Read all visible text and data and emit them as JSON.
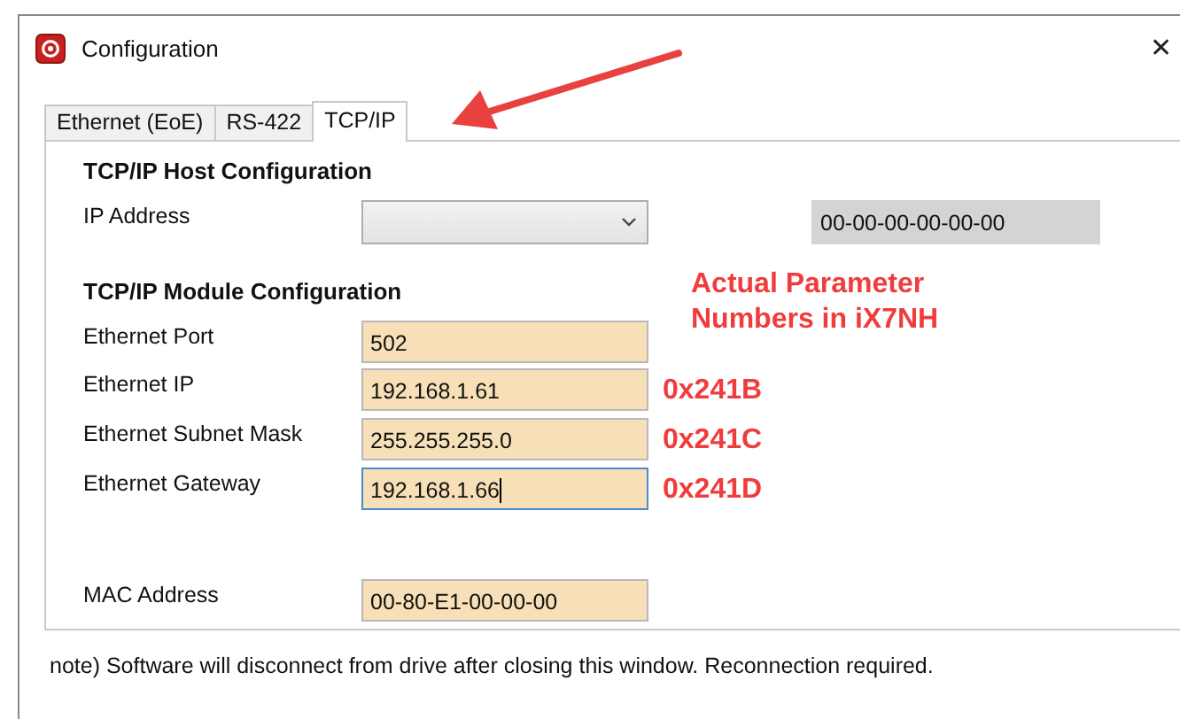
{
  "window": {
    "title": "Configuration",
    "close": "✕"
  },
  "tabs": [
    {
      "label": "Ethernet (EoE)",
      "selected": false
    },
    {
      "label": "RS-422",
      "selected": false
    },
    {
      "label": "TCP/IP",
      "selected": true
    }
  ],
  "host": {
    "heading": "TCP/IP Host Configuration",
    "label": "IP Address",
    "display": "00-00-00-00-00-00"
  },
  "module": {
    "heading": "TCP/IP Module Configuration",
    "annotation": "Actual Parameter Numbers in iX7NH",
    "rows": [
      {
        "label": "Ethernet Port",
        "value": "502",
        "focused": false
      },
      {
        "label": "Ethernet IP",
        "value": "192.168.1.61",
        "focused": false,
        "code": "0x241B"
      },
      {
        "label": "Ethernet Subnet Mask",
        "value": "255.255.255.0",
        "focused": false,
        "code": "0x241C"
      },
      {
        "label": "Ethernet Gateway",
        "value": "192.168.1.66",
        "focused": true,
        "code": "0x241D"
      }
    ]
  },
  "mac": {
    "label": "MAC Address",
    "value": "00-80-E1-00-00-00"
  },
  "note": "note) Software will disconnect from drive after closing this window.  Reconnection required."
}
